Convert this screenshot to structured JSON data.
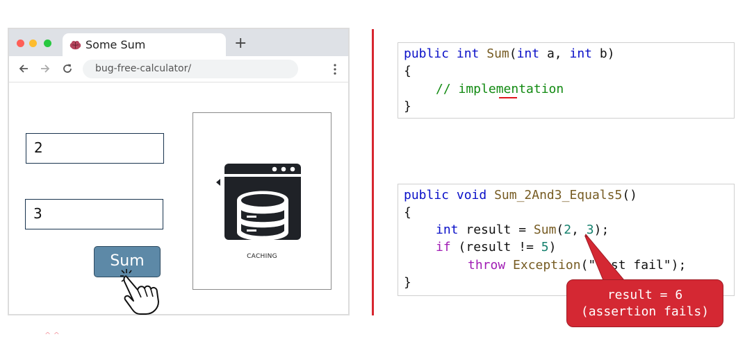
{
  "browser": {
    "tab_title": "Some Sum",
    "new_tab": "+",
    "url": "bug-free-calculator/"
  },
  "form": {
    "input_a": "2",
    "input_b": "3",
    "sum_label": "Sum"
  },
  "cache_card": {
    "label": "CACHING"
  },
  "carets": "^ ^",
  "code_impl": {
    "kw_public": "public",
    "kw_int": "int",
    "fn_name": "Sum",
    "kw_int_a": "int",
    "param_a": "a",
    "kw_int_b": "int",
    "param_b": "b",
    "open_brace": "{",
    "comment": "// implementation",
    "close_brace": "}"
  },
  "code_test": {
    "kw_public": "public",
    "kw_void": "void",
    "fn_name": "Sum_2And3_Equals5",
    "parens": "()",
    "open_brace": "{",
    "kw_int": "int",
    "var_decl": "result = ",
    "call_fn": "Sum",
    "arg_a": "2",
    "arg_b": "3",
    "kw_if": "if",
    "cond_left": "(result != ",
    "cond_num": "5",
    "cond_right": ")",
    "kw_throw": "throw",
    "exception": "Exception",
    "throw_msg": "(\"Test fail\");",
    "close_brace": "}"
  },
  "callout": {
    "line1": "result = 6",
    "line2": "(assertion fails)"
  },
  "colors": {
    "divider": "#d7262f",
    "button": "#5d89a7",
    "callout": "#d42833",
    "keyword": "#0a10c8",
    "comment": "#128a12"
  }
}
